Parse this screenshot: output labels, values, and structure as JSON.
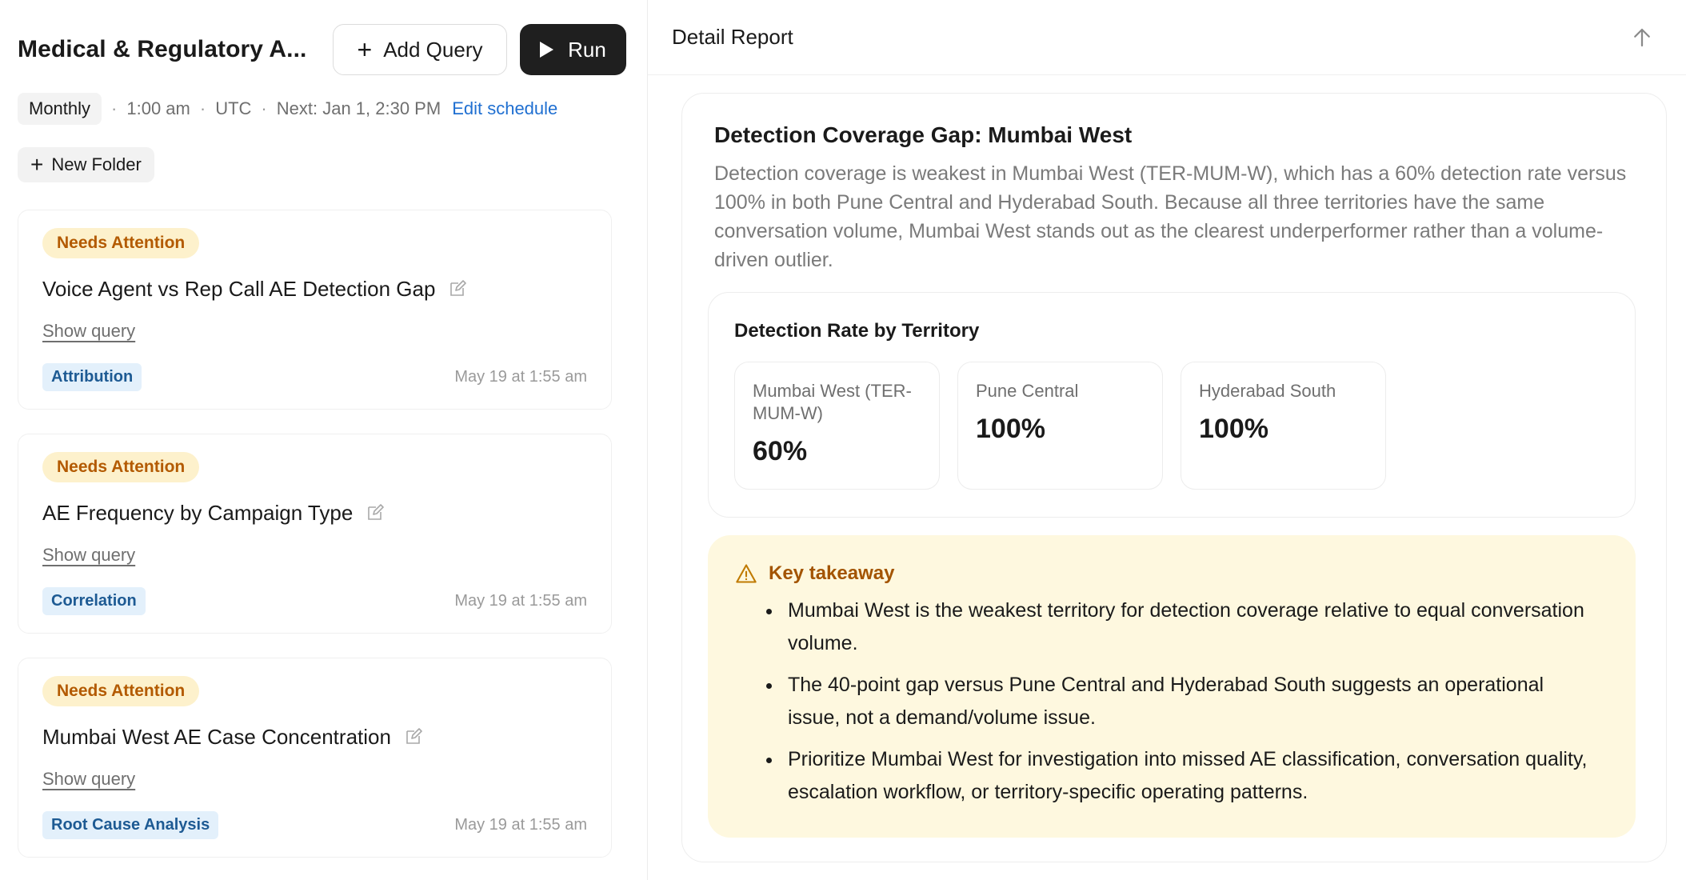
{
  "header": {
    "app_title": "Medical & Regulatory A...",
    "add_query_label": "Add Query",
    "run_label": "Run"
  },
  "schedule": {
    "frequency": "Monthly",
    "time": "1:00 am",
    "timezone": "UTC",
    "next": "Next: Jan 1, 2:30 PM",
    "edit_label": "Edit schedule",
    "separator": "·"
  },
  "new_folder_label": "New Folder",
  "queries": [
    {
      "status": "Needs Attention",
      "title": "Voice Agent vs Rep Call AE Detection Gap",
      "show_query": "Show query",
      "tag": "Attribution",
      "timestamp": "May 19 at 1:55 am"
    },
    {
      "status": "Needs Attention",
      "title": "AE Frequency by Campaign Type",
      "show_query": "Show query",
      "tag": "Correlation",
      "timestamp": "May 19 at 1:55 am"
    },
    {
      "status": "Needs Attention",
      "title": "Mumbai West AE Case Concentration",
      "show_query": "Show query",
      "tag": "Root Cause Analysis",
      "timestamp": "May 19 at 1:55 am"
    }
  ],
  "report": {
    "panel_title": "Detail Report",
    "title": "Detection Coverage Gap: Mumbai West",
    "description": "Detection coverage is weakest in Mumbai West (TER-MUM-W), which has a 60% detection rate versus 100% in both Pune Central and Hyderabad South. Because all three territories have the same conversation volume, Mumbai West stands out as the clearest underperformer rather than a volume-driven outlier.",
    "rates_title": "Detection Rate by Territory",
    "rates": [
      {
        "label": "Mumbai West (TER-MUM-W)",
        "value": "60%"
      },
      {
        "label": "Pune Central",
        "value": "100%"
      },
      {
        "label": "Hyderabad South",
        "value": "100%"
      }
    ],
    "takeaway_title": "Key takeaway",
    "takeaways": [
      "Mumbai West is the weakest territory for detection coverage relative to equal conversation volume.",
      "The 40-point gap versus Pune Central and Hyderabad South suggests an operational issue, not a demand/volume issue.",
      "Prioritize Mumbai West for investigation into missed AE classification, conversation quality, escalation workflow, or territory-specific operating patterns."
    ]
  },
  "colors": {
    "attention_bg": "#fdf1cc",
    "attention_text": "#b35a00",
    "tag_bg": "#e3f0fb",
    "tag_text": "#1d5a93",
    "link": "#1f6fd1",
    "run_button": "#1f1f1f",
    "takeaway_bg": "#fef8df"
  },
  "icons": {
    "add": "plus-icon",
    "run": "play-icon",
    "edit": "edit-icon",
    "collapse": "arrow-up-icon",
    "warning": "warning-icon"
  }
}
